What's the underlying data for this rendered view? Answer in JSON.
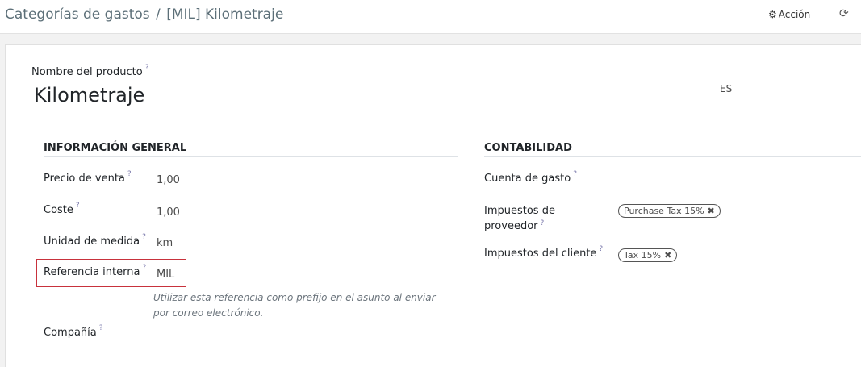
{
  "breadcrumb": {
    "parent": "Categorías de gastos",
    "separator": "/",
    "current": "[MIL] Kilometraje"
  },
  "toolbar": {
    "action_label": "Acción",
    "action_icon": "gear-icon",
    "reload_icon": "refresh-icon"
  },
  "form": {
    "product_label": "Nombre del producto",
    "product_name": "Kilometraje",
    "lang": "ES",
    "help_marker": "?",
    "general": {
      "title": "INFORMACIÓN GENERAL",
      "sale_price_label": "Precio de venta",
      "sale_price": "1,00",
      "cost_label": "Coste",
      "cost": "1,00",
      "uom_label": "Unidad de medida",
      "uom": "km",
      "ref_label": "Referencia interna",
      "ref": "MIL",
      "ref_help": "Utilizar esta referencia como prefijo en el asunto al enviar por correo electrónico.",
      "company_label": "Compañía"
    },
    "accounting": {
      "title": "CONTABILIDAD",
      "expense_account_label": "Cuenta de gasto",
      "vendor_taxes_label_1": "Impuestos de",
      "vendor_taxes_label_2": "proveedor",
      "vendor_tax_tag": "Purchase Tax 15%",
      "customer_taxes_label": "Impuestos del cliente",
      "customer_tax_tag": "Tax 15%",
      "tag_remove": "✖"
    }
  },
  "colors": {
    "highlight": "#c8323c",
    "help_marker": "#7c7bad"
  }
}
